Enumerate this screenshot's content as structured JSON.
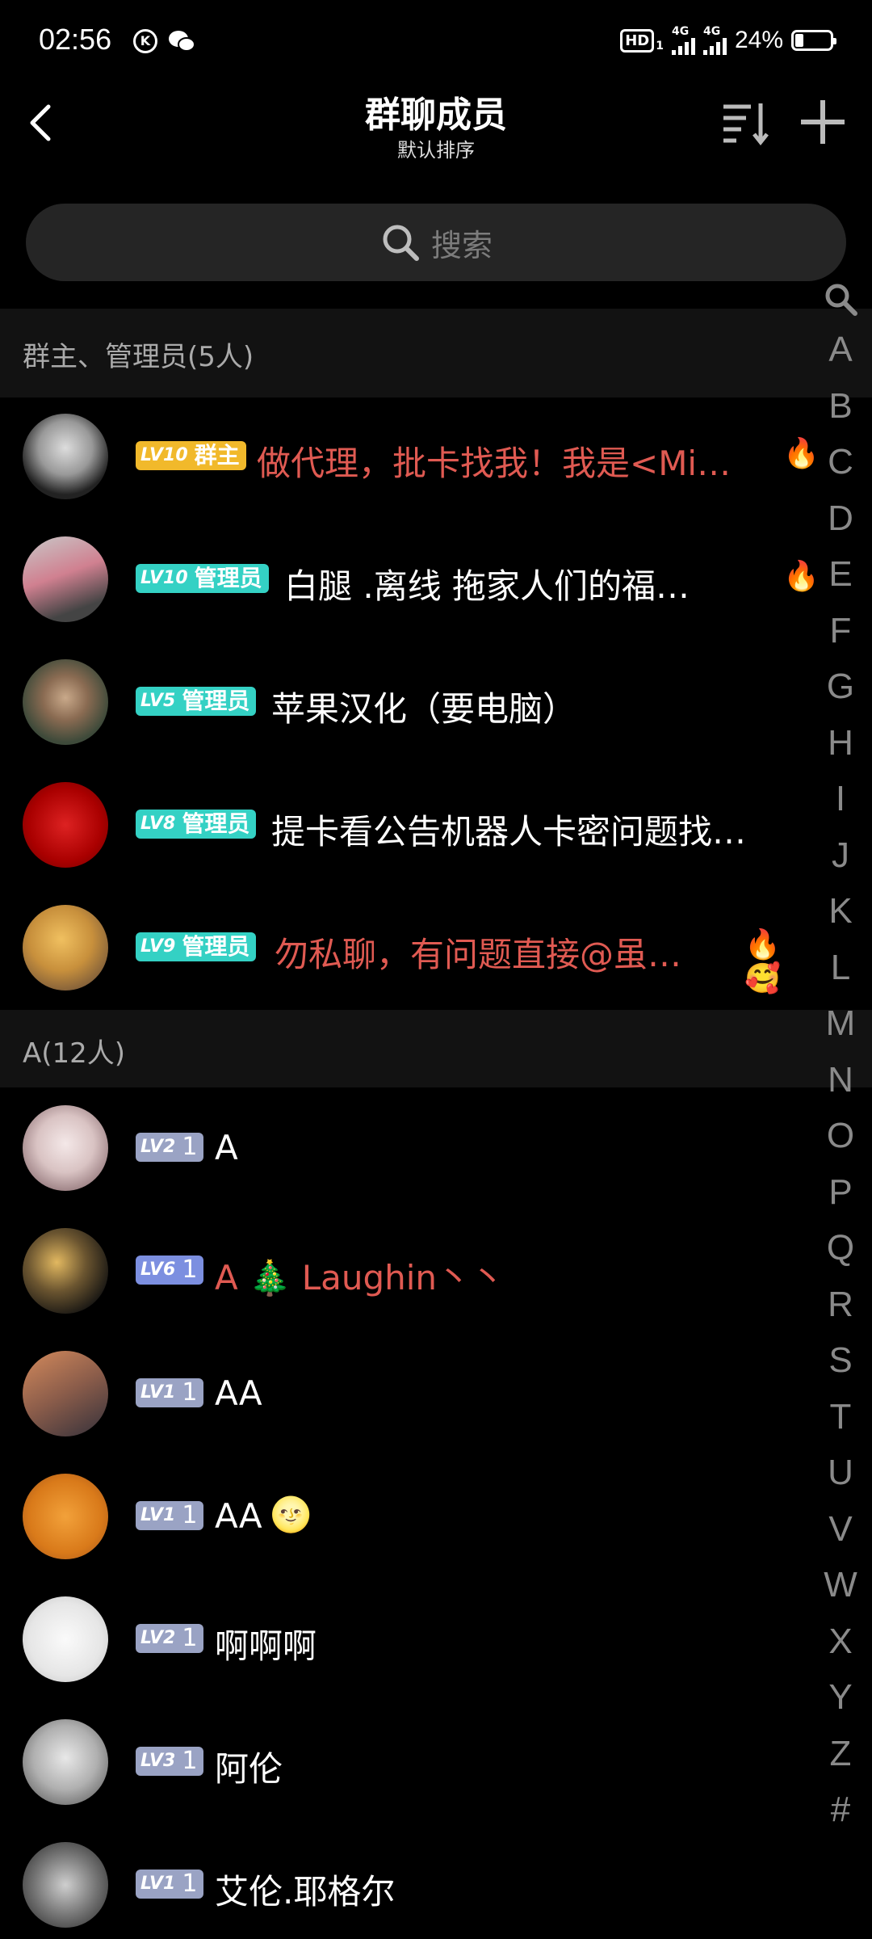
{
  "status_bar": {
    "time": "02:56",
    "hd": "HD",
    "hd_sub": "1",
    "net1": "4G",
    "net2": "4G",
    "battery": "24%",
    "battery_level": 0.24
  },
  "header": {
    "title": "群聊成员",
    "subtitle": "默认排序"
  },
  "search": {
    "placeholder": "搜索"
  },
  "sections": {
    "admins_title": "群主、管理员(5人)",
    "a_title": "A(12人)"
  },
  "admins": [
    {
      "level": "LV10",
      "role": "群主",
      "name": "做代理，批卡找我！我是<Mi…",
      "emoji": "🔥"
    },
    {
      "level": "LV10",
      "role": "管理员",
      "name": "白腿  .离线   拖家人们的福…",
      "emoji": "🔥"
    },
    {
      "level": "LV5",
      "role": "管理员",
      "name": "苹果汉化（要电脑）",
      "emoji": ""
    },
    {
      "level": "LV8",
      "role": "管理员",
      "name": "提卡看公告机器人卡密问题找…",
      "emoji": ""
    },
    {
      "level": "LV9",
      "role": "管理员",
      "name": "勿私聊，有问题直接@虽…",
      "emoji": "🔥🥰"
    }
  ],
  "members": [
    {
      "level": "LV2",
      "tag": "1",
      "name": "A",
      "emoji": ""
    },
    {
      "level": "LV6",
      "tag": "1",
      "name": "A 🎄 Laughin丶丶",
      "emoji": ""
    },
    {
      "level": "LV1",
      "tag": "1",
      "name": "AA",
      "emoji": ""
    },
    {
      "level": "LV1",
      "tag": "1",
      "name": "AA",
      "emoji": "🌝"
    },
    {
      "level": "LV2",
      "tag": "1",
      "name": "啊啊啊",
      "emoji": ""
    },
    {
      "level": "LV3",
      "tag": "1",
      "name": "阿伦",
      "emoji": ""
    },
    {
      "level": "LV1",
      "tag": "1",
      "name": "艾伦.耶格尔",
      "emoji": ""
    }
  ],
  "index_letters": [
    "A",
    "B",
    "C",
    "D",
    "E",
    "F",
    "G",
    "H",
    "I",
    "J",
    "K",
    "L",
    "M",
    "N",
    "O",
    "P",
    "Q",
    "R",
    "S",
    "T",
    "U",
    "V",
    "W",
    "X",
    "Y",
    "Z",
    "#"
  ],
  "colors": {
    "owner_badge": "#f1b92b",
    "admin_badge": "#34d1c4",
    "member_badge": "#9aa3c4",
    "highlight_name": "#e05a52"
  }
}
